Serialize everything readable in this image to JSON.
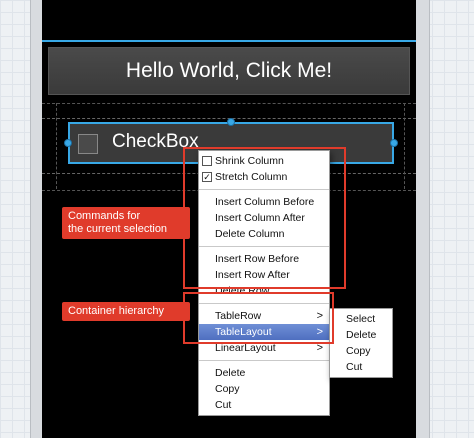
{
  "app": {
    "hello_button": "Hello World, Click Me!",
    "checkbox_label": "CheckBox"
  },
  "context_menu": {
    "table_items": [
      {
        "label": "Shrink Column",
        "checked": false
      },
      {
        "label": "Stretch Column",
        "checked": true
      }
    ],
    "column_items": [
      "Insert Column Before",
      "Insert Column After",
      "Delete Column"
    ],
    "row_items": [
      "Insert Row Before",
      "Insert Row After",
      "Delete Row"
    ],
    "hierarchy_items": [
      "TableRow",
      "TableLayout",
      "LinearLayout"
    ],
    "highlighted_item": "TableLayout",
    "edit_items": [
      "Delete",
      "Copy",
      "Cut"
    ]
  },
  "submenu": {
    "items": [
      "Select",
      "Delete",
      "Copy",
      "Cut"
    ]
  },
  "annotations": {
    "commands_line1": "Commands for",
    "commands_line2": "the current selection",
    "container_hierarchy": "Container hierarchy"
  },
  "colors": {
    "accent_blue": "#38a8e6",
    "annotation_red": "#e03b2b",
    "menu_highlight": "#5a7bc8"
  }
}
